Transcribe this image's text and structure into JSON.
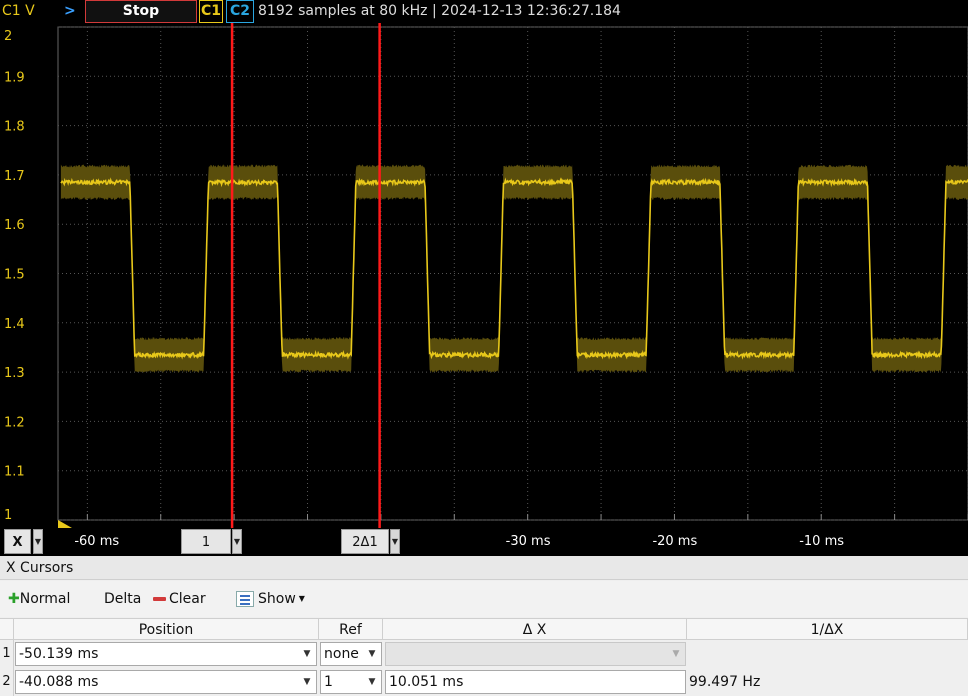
{
  "topbar": {
    "channel_unit_label": "C1 V",
    "run_arrow": ">",
    "stop_label": "Stop",
    "channel1_label": "C1",
    "channel2_label": "C2",
    "status_text": "8192 samples at 80 kHz | 2024-12-13 12:36:27.184"
  },
  "colors": {
    "background": "#000000",
    "trace": "#e8c81a",
    "trace_envelope": "#5a4e0c",
    "cursor": "#ff1a1a",
    "channel2": "#2aa6e0",
    "grid": "#555555"
  },
  "plot": {
    "y_ticks": [
      "2",
      "1.9",
      "1.8",
      "1.7",
      "1.6",
      "1.5",
      "1.4",
      "1.3",
      "1.2",
      "1.1",
      "1"
    ],
    "y_range": [
      1,
      2
    ],
    "x_range_ms": [
      -62,
      0
    ],
    "signal": {
      "high_v": 1.685,
      "low_v": 1.335,
      "period_ms": 10.05,
      "duty": 0.5,
      "first_fall_ms": -57.1
    },
    "cursors_ms": [
      -50.139,
      -40.088
    ]
  },
  "xaxis": {
    "axis_button": "X",
    "cursor1_button": "1",
    "cursor2_button": "2Δ1",
    "ticks": [
      "-60 ms",
      "-30 ms",
      "-20 ms",
      "-10 ms"
    ],
    "tick_values_ms": [
      -60,
      -30,
      -20,
      -10
    ]
  },
  "cursor_panel": {
    "title": "X Cursors",
    "toolbar": {
      "normal": "Normal",
      "delta": "Delta",
      "clear": "Clear",
      "show": "Show"
    },
    "columns": [
      "Position",
      "Ref",
      "Δ X",
      "1/ΔX"
    ],
    "rows": [
      {
        "index": "1",
        "position": "-50.139 ms",
        "ref": "none",
        "delta_x": "",
        "inv_delta_x": ""
      },
      {
        "index": "2",
        "position": "-40.088 ms",
        "ref": "1",
        "delta_x": "10.051 ms",
        "inv_delta_x": "99.497 Hz"
      }
    ]
  }
}
